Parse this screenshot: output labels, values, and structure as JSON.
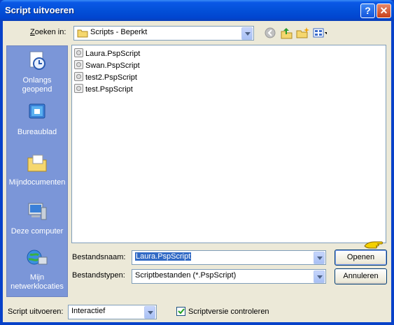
{
  "window": {
    "title": "Script uitvoeren",
    "help": "?",
    "close": "✕"
  },
  "lookin": {
    "label": "Zoeken in:",
    "value": "Scripts - Beperkt"
  },
  "places": [
    {
      "label": "Onlangs geopend",
      "icon": "recent-documents-icon"
    },
    {
      "label": "Bureaublad",
      "icon": "desktop-icon"
    },
    {
      "label": "Mijndocumenten",
      "icon": "my-documents-icon"
    },
    {
      "label": "Deze computer",
      "icon": "my-computer-icon"
    },
    {
      "label": "Mijn netwerklocaties",
      "icon": "network-places-icon"
    }
  ],
  "files": [
    "Laura.PspScript",
    "Swan.PspScript",
    "test2.PspScript",
    "test.PspScript"
  ],
  "filename": {
    "label": "Bestandsnaam:",
    "value": "Laura.PspScript"
  },
  "filetype": {
    "label": "Bestandstypen:",
    "value": "Scriptbestanden (*.PspScript)"
  },
  "buttons": {
    "open": "Openen",
    "cancel": "Annuleren"
  },
  "run": {
    "label": "Script uitvoeren:",
    "value": "Interactief"
  },
  "checkbox": {
    "label": "Scriptversie controleren",
    "checked": true
  }
}
